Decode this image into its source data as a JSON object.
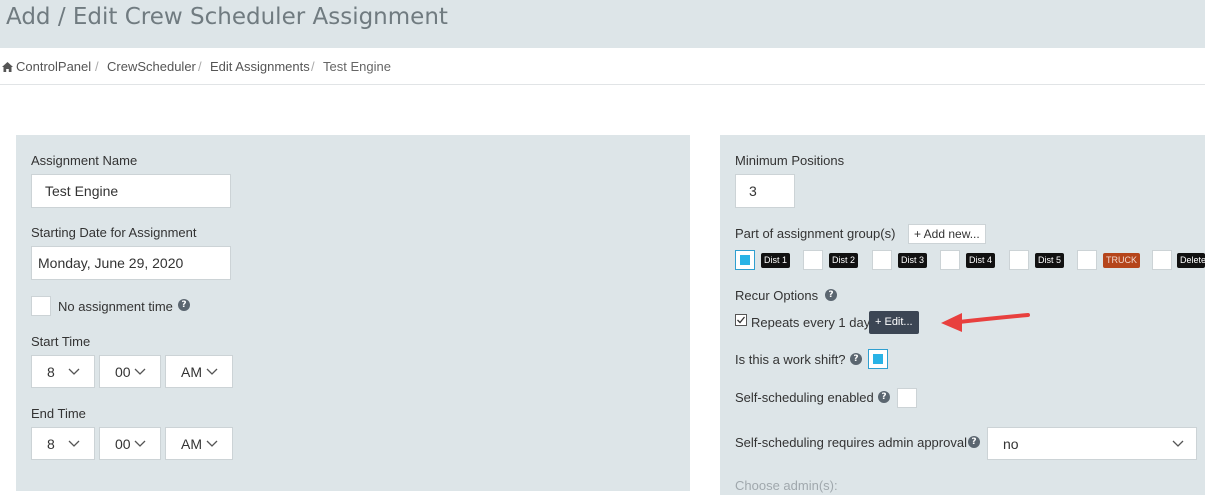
{
  "page": {
    "title": "Add / Edit Crew Scheduler Assignment"
  },
  "breadcrumb": {
    "items": [
      "ControlPanel",
      "CrewScheduler",
      "Edit Assignments",
      "Test Engine"
    ],
    "separator": "/"
  },
  "left": {
    "assignment_name_label": "Assignment Name",
    "assignment_name_value": "Test Engine",
    "start_date_label": "Starting Date for Assignment",
    "start_date_value": "Monday, June 29, 2020",
    "no_assignment_time_label": "No assignment time",
    "start_time_label": "Start Time",
    "start_time": {
      "hour": "8",
      "minute": "00",
      "ampm": "AM"
    },
    "end_time_label": "End Time",
    "end_time": {
      "hour": "8",
      "minute": "00",
      "ampm": "AM"
    }
  },
  "right": {
    "min_positions_label": "Minimum Positions",
    "min_positions_value": "3",
    "groups_label": "Part of assignment group(s)",
    "add_new_label": "+ Add new...",
    "groups": [
      {
        "label": "Dist 1",
        "color": "#111111",
        "checked": true
      },
      {
        "label": "Dist 2",
        "color": "#111111",
        "checked": false
      },
      {
        "label": "Dist 3",
        "color": "#111111",
        "checked": false
      },
      {
        "label": "Dist 4",
        "color": "#111111",
        "checked": false
      },
      {
        "label": "Dist 5",
        "color": "#111111",
        "checked": false
      },
      {
        "label": "TRUCK",
        "color": "#b5451b",
        "checked": false
      },
      {
        "label": "Delete",
        "color": "#111111",
        "checked": false
      }
    ],
    "recur_label": "Recur Options",
    "repeats_label": "Repeats every 1 days",
    "edit_button_label": "+ Edit...",
    "work_shift_label": "Is this a work shift?",
    "self_sched_label": "Self-scheduling enabled",
    "self_sched_approval_label": "Self-scheduling requires admin approval",
    "self_sched_approval_value": "no",
    "choose_admin_label": "Choose admin(s):"
  },
  "icons": {
    "help": "question-circle",
    "home": "home-icon",
    "chevron": "chevron-down",
    "arrow": "red-arrow"
  },
  "colors": {
    "header_bg": "#dde5e8",
    "accent_blue": "#29b3e6",
    "edit_button_bg": "#3c4654",
    "arrow_red": "#e8403e"
  }
}
